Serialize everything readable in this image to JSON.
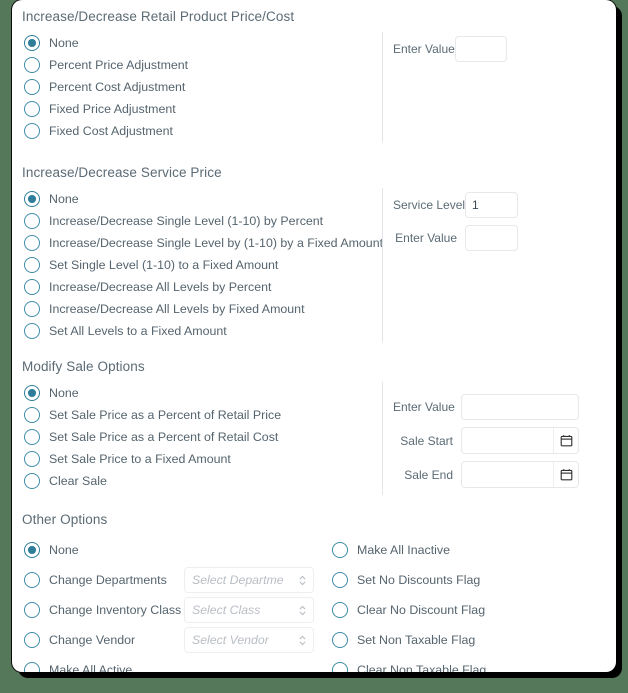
{
  "sections": [
    {
      "title": "Increase/Decrease Retail Product Price/Cost",
      "options": [
        {
          "label": "None",
          "checked": true
        },
        {
          "label": "Percent Price Adjustment",
          "checked": false
        },
        {
          "label": "Percent Cost Adjustment",
          "checked": false
        },
        {
          "label": "Fixed Price Adjustment",
          "checked": false
        },
        {
          "label": "Fixed Cost Adjustment",
          "checked": false
        }
      ],
      "fields": [
        {
          "label": "Enter Value",
          "value": "",
          "type": "text"
        }
      ]
    },
    {
      "title": "Increase/Decrease Service Price",
      "options": [
        {
          "label": "None",
          "checked": true
        },
        {
          "label": "Increase/Decrease Single Level (1-10) by Percent",
          "checked": false
        },
        {
          "label": "Increase/Decrease Single Level by (1-10) by a Fixed Amount",
          "checked": false
        },
        {
          "label": "Set Single Level (1-10) to a Fixed Amount",
          "checked": false
        },
        {
          "label": "Increase/Decrease All Levels by Percent",
          "checked": false
        },
        {
          "label": "Increase/Decrease All Levels by Fixed Amount",
          "checked": false
        },
        {
          "label": "Set All Levels to a Fixed Amount",
          "checked": false
        }
      ],
      "fields": [
        {
          "label": "Service Level",
          "value": "1",
          "type": "text"
        },
        {
          "label": "Enter Value",
          "value": "",
          "type": "text"
        }
      ]
    },
    {
      "title": "Modify Sale Options",
      "options": [
        {
          "label": "None",
          "checked": true
        },
        {
          "label": "Set Sale Price as a Percent of Retail Price",
          "checked": false
        },
        {
          "label": "Set Sale Price as a Percent of Retail Cost",
          "checked": false
        },
        {
          "label": "Set Sale Price to a Fixed Amount",
          "checked": false
        },
        {
          "label": "Clear Sale",
          "checked": false
        }
      ],
      "fields": [
        {
          "label": "Enter Value",
          "value": "",
          "type": "text"
        },
        {
          "label": "Sale Start",
          "value": "",
          "type": "date"
        },
        {
          "label": "Sale End",
          "value": "",
          "type": "date"
        }
      ]
    }
  ],
  "other_options": {
    "title": "Other Options",
    "left": [
      {
        "label": "None",
        "checked": true,
        "select": null
      },
      {
        "label": "Change Departments",
        "checked": false,
        "select": "Select Departme"
      },
      {
        "label": "Change Inventory Class",
        "checked": false,
        "select": "Select Class"
      },
      {
        "label": "Change Vendor",
        "checked": false,
        "select": "Select Vendor"
      },
      {
        "label": "Make All Active",
        "checked": false,
        "select": null
      }
    ],
    "right": [
      {
        "label": "Make All Inactive",
        "checked": false
      },
      {
        "label": "Set No Discounts Flag",
        "checked": false
      },
      {
        "label": "Clear No Discount Flag",
        "checked": false
      },
      {
        "label": "Set Non Taxable Flag",
        "checked": false
      },
      {
        "label": "Clear Non Taxable Flag",
        "checked": false
      }
    ]
  },
  "colors": {
    "accent": "#2f7e99",
    "radio_border": "#3f8ca8",
    "text": "#55646e",
    "label": "#5b6b75",
    "background": "#55775a",
    "card": "#ffffff"
  }
}
